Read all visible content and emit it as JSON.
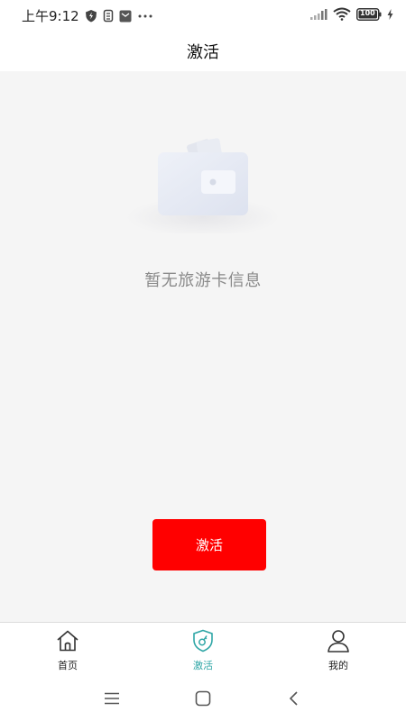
{
  "status_bar": {
    "time": "上午9:12",
    "battery": "100",
    "icons": [
      "shield-bolt-icon",
      "sim-icon",
      "notification-app-icon",
      "more-dots-icon",
      "signal-icon",
      "wifi-icon",
      "battery-icon",
      "charging-icon"
    ]
  },
  "header": {
    "title": "激活"
  },
  "empty_state": {
    "icon": "wallet-icon",
    "message": "暂无旅游卡信息"
  },
  "actions": {
    "activate_label": "激活"
  },
  "tabs": [
    {
      "label": "首页",
      "icon": "home-icon",
      "active": false
    },
    {
      "label": "激活",
      "icon": "shield-key-icon",
      "active": true
    },
    {
      "label": "我的",
      "icon": "user-icon",
      "active": false
    }
  ],
  "system_nav": {
    "icons": [
      "menu-icon",
      "home-square-icon",
      "back-icon"
    ]
  },
  "colors": {
    "accent": "#ff0000",
    "active_tab": "#2fa6a6",
    "background": "#f5f5f5"
  }
}
